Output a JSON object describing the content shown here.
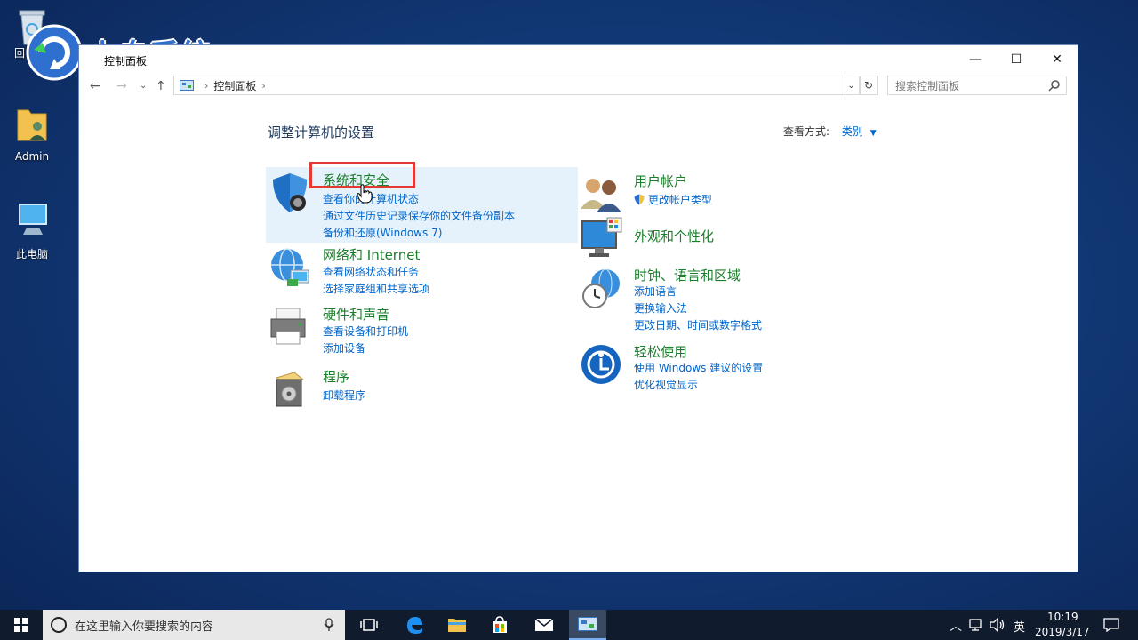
{
  "desktop": {
    "icons": [
      {
        "label": "回"
      },
      {
        "label": "Admin"
      },
      {
        "label": "此电脑"
      }
    ]
  },
  "watermark": {
    "text": "小白系统"
  },
  "window": {
    "title": "控制面板",
    "controls": {
      "minimize": "—",
      "maximize": "☐",
      "close": "✕"
    },
    "address": {
      "crumb": "控制面板"
    },
    "search": {
      "placeholder": "搜索控制面板"
    }
  },
  "main": {
    "heading": "调整计算机的设置",
    "view_by": {
      "label": "查看方式:",
      "value": "类别"
    },
    "categories_left": [
      {
        "title": "系统和安全",
        "links": [
          "查看你的计算机状态",
          "通过文件历史记录保存你的文件备份副本",
          "备份和还原(Windows 7)"
        ]
      },
      {
        "title": "网络和 Internet",
        "links": [
          "查看网络状态和任务",
          "选择家庭组和共享选项"
        ]
      },
      {
        "title": "硬件和声音",
        "links": [
          "查看设备和打印机",
          "添加设备"
        ]
      },
      {
        "title": "程序",
        "links": [
          "卸载程序"
        ]
      }
    ],
    "categories_right": [
      {
        "title": "用户帐户",
        "links": [
          "更改帐户类型"
        ]
      },
      {
        "title": "外观和个性化",
        "links": []
      },
      {
        "title": "时钟、语言和区域",
        "links": [
          "添加语言",
          "更换输入法",
          "更改日期、时间或数字格式"
        ]
      },
      {
        "title": "轻松使用",
        "links": [
          "使用 Windows 建议的设置",
          "优化视觉显示"
        ]
      }
    ]
  },
  "taskbar": {
    "search_text": "在这里输入你要搜索的内容",
    "ime": "英",
    "time": "10:19",
    "date": "2019/3/17"
  },
  "colors": {
    "accent": "#0066cc",
    "category_title": "#1a7f2a",
    "highlight": "#e5f1fb",
    "annotation": "#e53935"
  }
}
